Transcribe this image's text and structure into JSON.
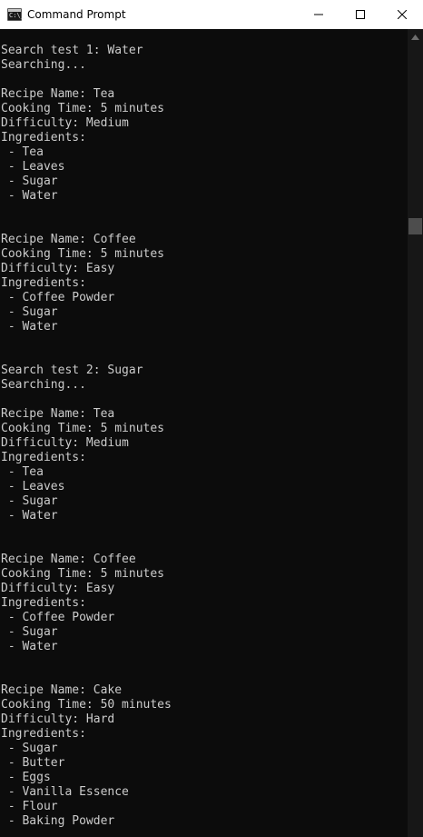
{
  "window": {
    "title": "Command Prompt",
    "icon": "cmd-icon",
    "icon_glyph": "C:\\_"
  },
  "controls": [
    "minimize-icon",
    "maximize-icon",
    "close-icon"
  ],
  "console": {
    "lines": [
      "",
      "Search test 1: Water",
      "Searching...",
      "",
      "Recipe Name: Tea",
      "Cooking Time: 5 minutes",
      "Difficulty: Medium",
      "Ingredients:",
      " - Tea",
      " - Leaves",
      " - Sugar",
      " - Water",
      "",
      "",
      "Recipe Name: Coffee",
      "Cooking Time: 5 minutes",
      "Difficulty: Easy",
      "Ingredients:",
      " - Coffee Powder",
      " - Sugar",
      " - Water",
      "",
      "",
      "Search test 2: Sugar",
      "Searching...",
      "",
      "Recipe Name: Tea",
      "Cooking Time: 5 minutes",
      "Difficulty: Medium",
      "Ingredients:",
      " - Tea",
      " - Leaves",
      " - Sugar",
      " - Water",
      "",
      "",
      "Recipe Name: Coffee",
      "Cooking Time: 5 minutes",
      "Difficulty: Easy",
      "Ingredients:",
      " - Coffee Powder",
      " - Sugar",
      " - Water",
      "",
      "",
      "Recipe Name: Cake",
      "Cooking Time: 50 minutes",
      "Difficulty: Hard",
      "Ingredients:",
      " - Sugar",
      " - Butter",
      " - Eggs",
      " - Vanilla Essence",
      " - Flour",
      " - Baking Powder"
    ]
  },
  "colors": {
    "console_bg": "#0c0c0c",
    "console_text": "#cccccc",
    "titlebar_bg": "#ffffff",
    "scroll_track": "#171717",
    "scroll_thumb": "#4d4d4d"
  }
}
